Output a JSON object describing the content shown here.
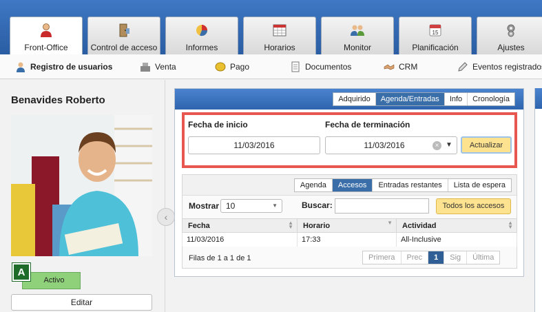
{
  "top_tabs": [
    {
      "label": "Front-Office",
      "icon": "person-icon",
      "active": true
    },
    {
      "label": "Control de acceso",
      "icon": "door-icon"
    },
    {
      "label": "Informes",
      "icon": "pie-chart-icon"
    },
    {
      "label": "Horarios",
      "icon": "calendar-grid-icon"
    },
    {
      "label": "Monitor",
      "icon": "group-icon"
    },
    {
      "label": "Planificación",
      "icon": "calendar-icon"
    },
    {
      "label": "Ajustes",
      "icon": "gears-icon"
    }
  ],
  "sub_menu": [
    {
      "label": "Registro de usuarios",
      "icon": "user-icon"
    },
    {
      "label": "Venta",
      "icon": "cash-register-icon"
    },
    {
      "label": "Pago",
      "icon": "coin-icon"
    },
    {
      "label": "Documentos",
      "icon": "document-icon"
    },
    {
      "label": "CRM",
      "icon": "handshake-icon"
    },
    {
      "label": "Eventos registrados",
      "icon": "pencil-icon"
    }
  ],
  "member": {
    "name": "Benavides Roberto",
    "badge": "A",
    "status": "Activo",
    "edit_label": "Editar"
  },
  "panel_tabs": [
    "Adquirido",
    "Agenda/Entradas",
    "Info",
    "Cronología"
  ],
  "panel_active_tab": "Agenda/Entradas",
  "date_filter": {
    "start_label": "Fecha de inicio",
    "start_value": "11/03/2016",
    "end_label": "Fecha de terminación",
    "end_value": "11/03/2016",
    "update_label": "Actualizar"
  },
  "sub_tabs": [
    "Agenda",
    "Accesos",
    "Entradas restantes",
    "Lista de espera"
  ],
  "sub_active_tab": "Accesos",
  "controls": {
    "show_label": "Mostrar",
    "show_value": "10",
    "search_label": "Buscar:",
    "search_value": "",
    "all_access_label": "Todos los accesos"
  },
  "table": {
    "columns": [
      "Fecha",
      "Horario",
      "Actividad"
    ],
    "rows": [
      [
        "11/03/2016",
        "17:33",
        "All-Inclusive"
      ]
    ]
  },
  "pagination": {
    "summary": "Filas de 1 a 1 de 1",
    "first": "Primera",
    "prev": "Prec",
    "current": "1",
    "next": "Sig",
    "last": "Última"
  },
  "colors": {
    "header_blue": "#2e64ad",
    "highlight_red": "#e8574f",
    "status_green": "#8fd17a",
    "badge_green": "#1f6b2a",
    "button_yellow": "#fde28f"
  }
}
